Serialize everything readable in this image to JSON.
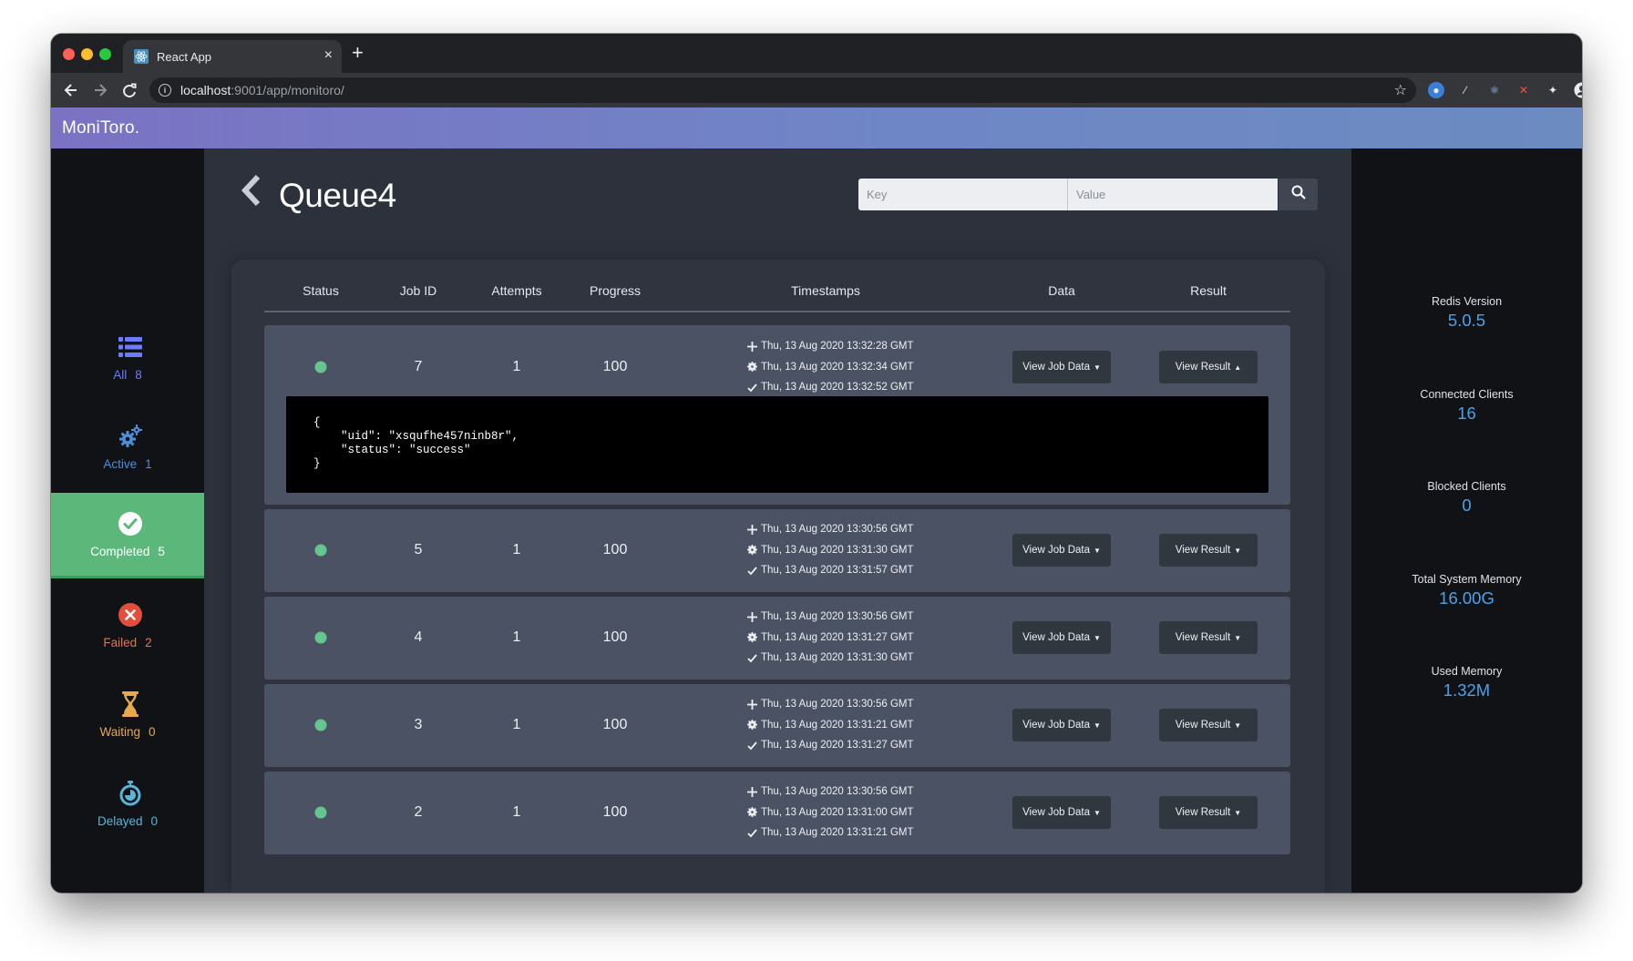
{
  "browser": {
    "tab_title": "React App",
    "url_host": "localhost",
    "url_path": ":9001/app/monitoro/"
  },
  "app": {
    "brand": "MoniToro."
  },
  "sidebar": {
    "items": [
      {
        "label": "All",
        "count": "8"
      },
      {
        "label": "Active",
        "count": "1"
      },
      {
        "label": "Completed",
        "count": "5"
      },
      {
        "label": "Failed",
        "count": "2"
      },
      {
        "label": "Waiting",
        "count": "0"
      },
      {
        "label": "Delayed",
        "count": "0"
      }
    ]
  },
  "main": {
    "queue_name": "Queue4",
    "search": {
      "key_placeholder": "Key",
      "value_placeholder": "Value"
    },
    "columns": [
      "Status",
      "Job ID",
      "Attempts",
      "Progress",
      "Timestamps",
      "Data",
      "Result"
    ],
    "view_data_label": "View Job Data",
    "view_result_label": "View Result",
    "jobs": [
      {
        "id": "7",
        "attempts": "1",
        "progress": "100",
        "created": "Thu, 13 Aug 2020 13:32:28 GMT",
        "processed": "Thu, 13 Aug 2020 13:32:34 GMT",
        "finished": "Thu, 13 Aug 2020 13:32:52 GMT"
      },
      {
        "id": "5",
        "attempts": "1",
        "progress": "100",
        "created": "Thu, 13 Aug 2020 13:30:56 GMT",
        "processed": "Thu, 13 Aug 2020 13:31:30 GMT",
        "finished": "Thu, 13 Aug 2020 13:31:57 GMT"
      },
      {
        "id": "4",
        "attempts": "1",
        "progress": "100",
        "created": "Thu, 13 Aug 2020 13:30:56 GMT",
        "processed": "Thu, 13 Aug 2020 13:31:27 GMT",
        "finished": "Thu, 13 Aug 2020 13:31:30 GMT"
      },
      {
        "id": "3",
        "attempts": "1",
        "progress": "100",
        "created": "Thu, 13 Aug 2020 13:30:56 GMT",
        "processed": "Thu, 13 Aug 2020 13:31:21 GMT",
        "finished": "Thu, 13 Aug 2020 13:31:27 GMT"
      },
      {
        "id": "2",
        "attempts": "1",
        "progress": "100",
        "created": "Thu, 13 Aug 2020 13:30:56 GMT",
        "processed": "Thu, 13 Aug 2020 13:31:00 GMT",
        "finished": "Thu, 13 Aug 2020 13:31:21 GMT"
      }
    ],
    "expanded_result": "{\n    \"uid\": \"xsqufhe457ninb8r\",\n    \"status\": \"success\"\n}"
  },
  "stats": [
    {
      "label": "Redis Version",
      "value": "5.0.5"
    },
    {
      "label": "Connected Clients",
      "value": "16"
    },
    {
      "label": "Blocked Clients",
      "value": "0"
    },
    {
      "label": "Total System Memory",
      "value": "16.00G"
    },
    {
      "label": "Used Memory",
      "value": "1.32M"
    }
  ],
  "colors": {
    "header_gradient_start": "#7b72c4",
    "header_gradient_end": "#6c8bc1",
    "completed_active": "#5cb87a",
    "status_dot": "#66c48f",
    "stat_value": "#4aa3e8",
    "row_bg": "#4a5263"
  }
}
